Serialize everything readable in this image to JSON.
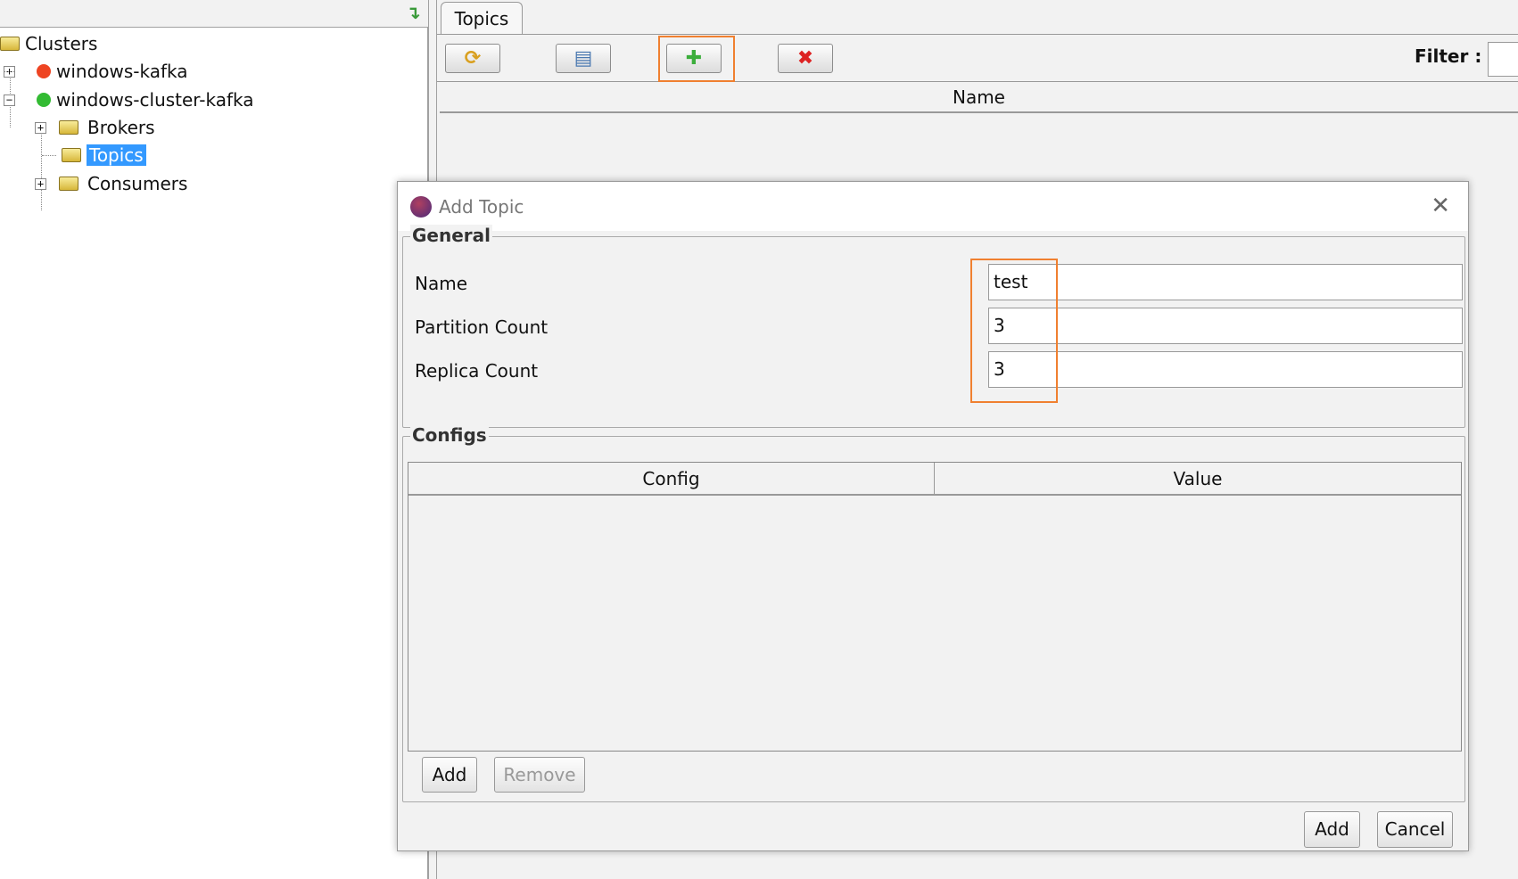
{
  "tree": {
    "root": "Clusters",
    "items": [
      {
        "label": "windows-kafka",
        "status_color": "#ee4422",
        "expanded": false
      },
      {
        "label": "windows-cluster-kafka",
        "status_color": "#33bb33",
        "expanded": true,
        "children": [
          {
            "label": "Brokers"
          },
          {
            "label": "Topics",
            "selected": true
          },
          {
            "label": "Consumers"
          }
        ]
      }
    ]
  },
  "tab": {
    "label": "Topics"
  },
  "toolbar": {
    "refresh": "refresh-icon",
    "print": "print-icon",
    "add": "add-icon",
    "delete": "delete-icon",
    "filter_label": "Filter :",
    "filter_value": ""
  },
  "table": {
    "header": "Name"
  },
  "dialog": {
    "title": "Add Topic",
    "general": {
      "legend": "General",
      "fields": [
        {
          "label": "Name",
          "value": "test"
        },
        {
          "label": "Partition Count",
          "value": "3"
        },
        {
          "label": "Replica Count",
          "value": "3"
        }
      ]
    },
    "configs": {
      "legend": "Configs",
      "columns": [
        "Config",
        "Value"
      ],
      "add": "Add",
      "remove": "Remove"
    },
    "ok": "Add",
    "cancel": "Cancel"
  },
  "colors": {
    "highlight": "#f08030",
    "selection": "#3399ff"
  }
}
